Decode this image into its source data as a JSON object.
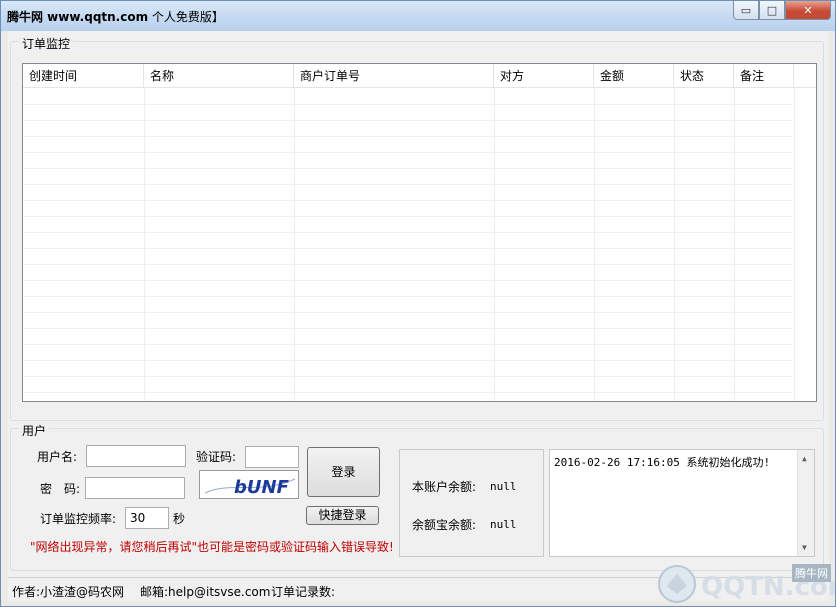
{
  "window": {
    "title_bold": "腾牛网 www.qqtn.com",
    "title_rest": " 个人免费版】",
    "min_glyph": "▭",
    "max_glyph": "□",
    "close_glyph": "✕"
  },
  "orders": {
    "legend": "订单监控",
    "columns": [
      "创建时间",
      "名称",
      "商户订单号",
      "对方",
      "金额",
      "状态",
      "备注"
    ]
  },
  "user": {
    "legend": "用户",
    "username_label": "用户名:",
    "username_value": "",
    "password_label": "密　码:",
    "password_value": "",
    "captcha_label": "验证码:",
    "captcha_value": "",
    "captcha_image_text": "bUNF",
    "login_button": "登录",
    "quick_login_button": "快捷登录",
    "frequency_label": "订单监控频率:",
    "frequency_value": "30",
    "frequency_unit": "秒",
    "error_hint": "\"网络出现异常，请您稍后再试\"也可能是密码或验证码输入错误导致!"
  },
  "balance": {
    "account_label": "本账户余额:",
    "account_value": "null",
    "yuebao_label": "余额宝余额:",
    "yuebao_value": "null"
  },
  "log": {
    "line1": "2016-02-26 17:16:05  系统初始化成功!"
  },
  "status": {
    "author": "作者:小渣渣@码农网",
    "email": "邮箱:help@itsvse.com",
    "order_count": "订单记录数:"
  },
  "watermark": {
    "text": "QQTN.com",
    "badge": "腾牛网"
  },
  "colors": {
    "error_text": "#c00000",
    "titlebar": "#c7dbf2",
    "close_button": "#c74c37"
  }
}
